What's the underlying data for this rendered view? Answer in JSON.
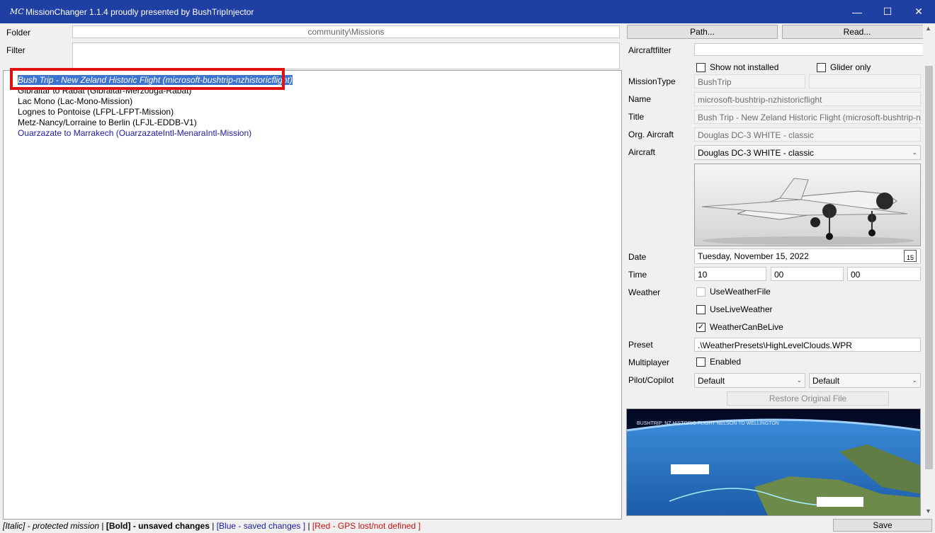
{
  "window": {
    "title": "MissionChanger 1.1.4 proudly presented by BushTripInjector",
    "icon": "mc-app-icon",
    "controls": {
      "minimize": "—",
      "maximize": "☐",
      "close": "✕"
    }
  },
  "left": {
    "folder_label": "Folder",
    "folder_value": "community\\Missions",
    "filter_label": "Filter",
    "filter_value": "",
    "missions": [
      {
        "text": "Bush Trip - New Zeland Historic Flight (microsoft-bushtrip-nzhistoricflight)",
        "style": "italic selected"
      },
      {
        "text": "Gibraltar to Rabat (Gibraltar-Merzouga-Rabat)",
        "style": ""
      },
      {
        "text": "Lac Mono (Lac-Mono-Mission)",
        "style": ""
      },
      {
        "text": "Lognes to Pontoise (LFPL-LFPT-Mission)",
        "style": ""
      },
      {
        "text": "Metz-Nancy/Lorraine to Berlin (LFJL-EDDB-V1)",
        "style": ""
      },
      {
        "text": "Ouarzazate to Marrakech (OuarzazateIntl-MenaraIntl-Mission)",
        "style": "blue"
      }
    ]
  },
  "right": {
    "path_button": "Path...",
    "read_button": "Read...",
    "aircraftfilter_label": "Aircraftfilter",
    "aircraftfilter_value": "",
    "show_not_installed": "Show not installed",
    "glider_only": "Glider only",
    "missiontype_label": "MissionType",
    "missiontype_value": "BushTrip",
    "missiontype_extra": "",
    "name_label": "Name",
    "name_value": "microsoft-bushtrip-nzhistoricflight",
    "title_label": "Title",
    "title_value": "Bush Trip - New Zeland Historic Flight (microsoft-bushtrip-nzhi",
    "org_aircraft_label": "Org. Aircraft",
    "org_aircraft_value": "Douglas DC-3 WHITE - classic",
    "aircraft_label": "Aircraft",
    "aircraft_value": "Douglas DC-3 WHITE - classic",
    "date_label": "Date",
    "date_value": "Tuesday, November 15, 2022",
    "calendar_day": "15",
    "time_label": "Time",
    "time_h": "10",
    "time_m": "00",
    "time_s": "00",
    "weather_label": "Weather",
    "use_weather_file": "UseWeatherFile",
    "use_live_weather": "UseLiveWeather",
    "weather_can_be_live": "WeatherCanBeLive",
    "weather_can_be_live_checked": "✓",
    "preset_label": "Preset",
    "preset_value": ".\\WeatherPresets\\HighLevelClouds.WPR",
    "multiplayer_label": "Multiplayer",
    "enabled_label": "Enabled",
    "pilot_label": "Pilot/Copilot",
    "pilot_value": "Default",
    "copilot_value": "Default",
    "restore_button": "Restore Original File",
    "save_button": "Save",
    "map_caption": "BUSHTRIP: NZ HISTORIC FLIGHT NELSON TO WELLINGTON"
  },
  "status": {
    "italic": "[Italic] - protected mission",
    "sep1": " | ",
    "bold": "[Bold] - unsaved changes",
    "sep2": " | ",
    "blue": "[Blue - saved changes ]",
    "sep3": " | ",
    "red": "[Red - GPS lost/not defined ]"
  }
}
